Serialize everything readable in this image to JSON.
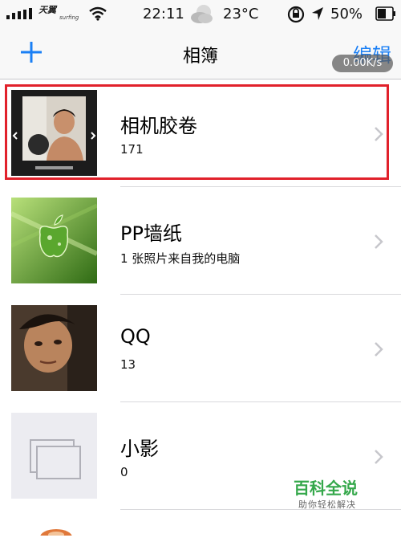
{
  "status_bar": {
    "carrier": "天翼",
    "carrier_sub": "surfing",
    "time": "22:11",
    "temperature": "23°C",
    "battery": "50%",
    "signal_icon": "signal-bars-icon",
    "wifi_icon": "wifi-icon",
    "weather_icon": "cloudy-moon-icon",
    "location_icon": "location-arrow-icon",
    "battery_icon": "battery-icon"
  },
  "nav": {
    "title": "相簿",
    "add_icon": "plus-icon",
    "edit_label": "编辑",
    "speed_badge": "0.00K/s",
    "accent_color": "#1a7ff5"
  },
  "albums": [
    {
      "title": "相机胶卷",
      "subtitle": "171",
      "thumb_icon": "camera-roll-thumbnail"
    },
    {
      "title": "PP墙纸",
      "subtitle": "1 张照片来自我的电脑",
      "thumb_icon": "apple-wallpaper-thumbnail"
    },
    {
      "title": "QQ",
      "subtitle": "13",
      "thumb_icon": "qq-album-thumbnail"
    },
    {
      "title": "小影",
      "subtitle": "0",
      "thumb_icon": "empty-album-icon"
    }
  ],
  "highlight_color": "#e1212b",
  "watermark": {
    "title": "百科全说",
    "subtitle": "助你轻松解决"
  }
}
